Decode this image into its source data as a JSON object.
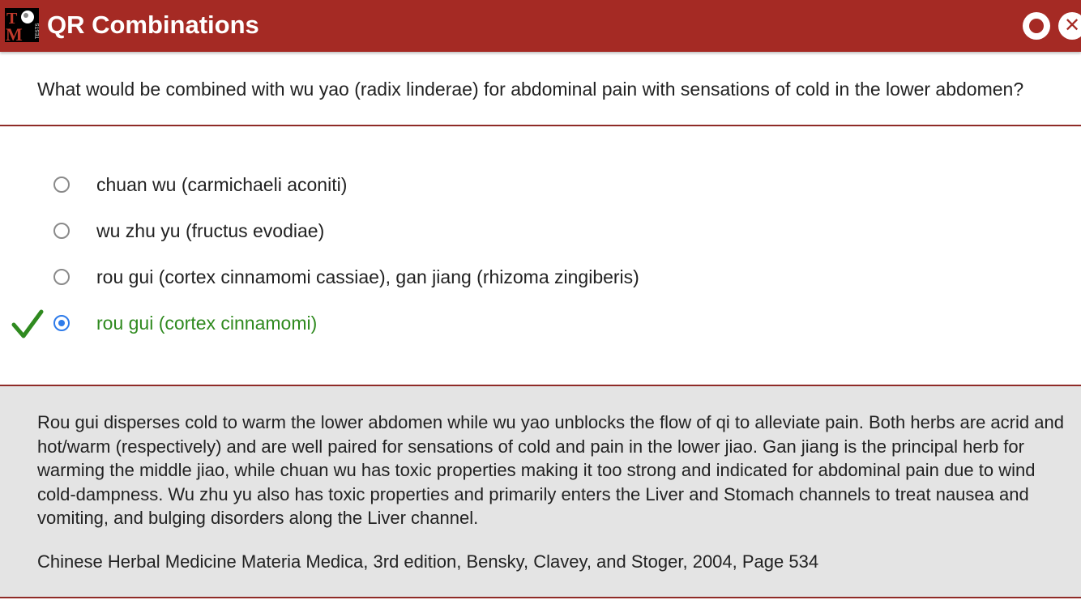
{
  "window": {
    "title": "QR Combinations",
    "logo_icon": "tcm-tests-logo-icon",
    "accent_color": "#a52a24"
  },
  "question": {
    "text": "What would be combined with wu yao (radix linderae) for abdominal pain with sensations of cold in the lower abdomen?"
  },
  "options": [
    {
      "label": "chuan wu (carmichaeli aconiti)",
      "selected": false,
      "correct": false
    },
    {
      "label": "wu zhu yu (fructus evodiae)",
      "selected": false,
      "correct": false
    },
    {
      "label": "rou gui (cortex cinnamomi cassiae), gan jiang (rhizoma zingiberis)",
      "selected": false,
      "correct": false
    },
    {
      "label": "rou gui (cortex cinnamomi)",
      "selected": true,
      "correct": true
    }
  ],
  "correct_color": "#2f8a1f",
  "selected_color": "#2e7bea",
  "explanation": {
    "text": "Rou gui disperses cold to warm the lower abdomen while wu yao unblocks the flow of qi to alleviate pain. Both herbs are acrid and hot/warm (respectively) and are well paired for sensations of cold and pain in the lower jiao. Gan jiang is the principal herb for warming the middle jiao, while chuan wu has toxic properties making it too strong and indicated for abdominal pain due to wind cold-dampness. Wu zhu yu also has toxic properties and primarily enters the Liver and Stomach channels to treat nausea and vomiting, and bulging disorders along the Liver channel.",
    "citation": "Chinese Herbal Medicine Materia Medica, 3rd edition, Bensky, Clavey, and Stoger, 2004, Page 534"
  }
}
